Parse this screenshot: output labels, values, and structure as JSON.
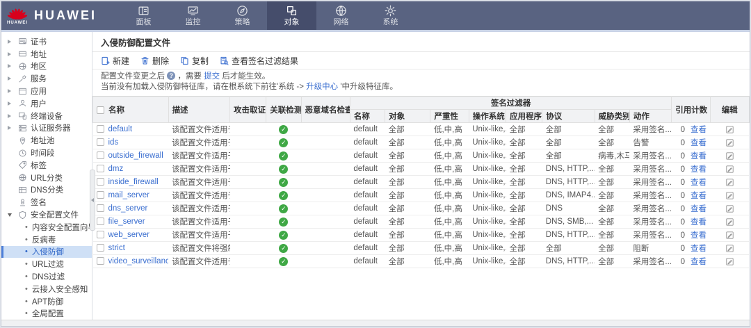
{
  "colors": {
    "topbar": "#596381",
    "topbar_active": "#454d6b",
    "link_blue": "#3b6fd0",
    "selected_item_bg": "#cfe0f6",
    "selected_item_border": "#4d7fd9",
    "success_green": "#3fa845",
    "huawei_red": "#d8001c"
  },
  "brand": {
    "name": "HUAWEI",
    "logo_caption": "HUAWEI",
    "logo_icon": "huawei-logo"
  },
  "top_nav": {
    "items": [
      {
        "id": "dashboard",
        "label": "面板",
        "icon": "dashboard-icon",
        "active": false
      },
      {
        "id": "monitor",
        "label": "监控",
        "icon": "monitor-icon",
        "active": false
      },
      {
        "id": "policy",
        "label": "策略",
        "icon": "policy-icon",
        "active": false
      },
      {
        "id": "objects",
        "label": "对象",
        "icon": "objects-icon",
        "active": true
      },
      {
        "id": "network",
        "label": "网络",
        "icon": "network-icon",
        "active": false
      },
      {
        "id": "system",
        "label": "系统",
        "icon": "system-icon",
        "active": false
      }
    ]
  },
  "sidebar": {
    "items": [
      {
        "id": "certificate",
        "label": "证书",
        "icon": "certificate-icon",
        "arrow": "collapsed"
      },
      {
        "id": "address",
        "label": "地址",
        "icon": "address-icon",
        "arrow": "collapsed"
      },
      {
        "id": "region",
        "label": "地区",
        "icon": "region-icon",
        "arrow": "collapsed"
      },
      {
        "id": "service",
        "label": "服务",
        "icon": "service-icon",
        "arrow": "collapsed"
      },
      {
        "id": "application",
        "label": "应用",
        "icon": "application-icon",
        "arrow": "collapsed"
      },
      {
        "id": "user",
        "label": "用户",
        "icon": "user-icon",
        "arrow": "collapsed"
      },
      {
        "id": "terminal-device",
        "label": "终端设备",
        "icon": "terminal-device-icon",
        "arrow": "collapsed"
      },
      {
        "id": "auth-server",
        "label": "认证服务器",
        "icon": "auth-server-icon",
        "arrow": "collapsed"
      },
      {
        "id": "address-pool",
        "label": "地址池",
        "icon": "address-pool-icon"
      },
      {
        "id": "time-range",
        "label": "时间段",
        "icon": "time-range-icon"
      },
      {
        "id": "tag",
        "label": "标签",
        "icon": "tag-icon"
      },
      {
        "id": "url-category",
        "label": "URL分类",
        "icon": "url-category-icon"
      },
      {
        "id": "dns-category",
        "label": "DNS分类",
        "icon": "dns-category-icon"
      },
      {
        "id": "signature",
        "label": "签名",
        "icon": "signature-icon"
      },
      {
        "id": "security-profile",
        "label": "安全配置文件",
        "icon": "security-profile-icon",
        "arrow": "expanded"
      },
      {
        "id": "content-security-wizard",
        "label": "内容安全配置向导",
        "child": true
      },
      {
        "id": "antivirus",
        "label": "反病毒",
        "child": true
      },
      {
        "id": "intrusion-prevention",
        "label": "入侵防御",
        "child": true,
        "selected": true
      },
      {
        "id": "url-filter",
        "label": "URL过滤",
        "child": true
      },
      {
        "id": "dns-filter",
        "label": "DNS过滤",
        "child": true
      },
      {
        "id": "cloud-access-security",
        "label": "云接入安全感知",
        "child": true
      },
      {
        "id": "apt-defense",
        "label": "APT防御",
        "child": true
      },
      {
        "id": "global-config",
        "label": "全局配置",
        "child": true
      }
    ]
  },
  "main": {
    "title": "入侵防御配置文件",
    "toolbar": [
      {
        "id": "new",
        "label": "新建",
        "icon": "new-icon"
      },
      {
        "id": "delete",
        "label": "删除",
        "icon": "delete-icon"
      },
      {
        "id": "copy",
        "label": "复制",
        "icon": "copy-icon"
      },
      {
        "id": "view-signature-filter-results",
        "label": "查看签名过滤结果",
        "icon": "view-results-icon"
      }
    ],
    "notice": {
      "line1_pre": "配置文件变更之后",
      "help_glyph": "?",
      "line1_mid": "，需要",
      "line1_link": "提交",
      "line1_post": "后才能生效。",
      "line2_pre": "当前没有加载入侵防御特征库，请在根系统下前往'系统 ->",
      "line2_link": "升级中心",
      "line2_post": "'中升级特征库。"
    },
    "table": {
      "main_columns": [
        {
          "id": "name",
          "label": "名称"
        },
        {
          "id": "description",
          "label": "描述"
        },
        {
          "id": "attack-evidence",
          "label": "攻击取证"
        },
        {
          "id": "correlation-detection",
          "label": "关联检测"
        },
        {
          "id": "malicious-domain-check",
          "label": "恶意域名检查"
        }
      ],
      "filter_group": {
        "label": "签名过滤器",
        "columns": [
          {
            "id": "filter-name",
            "label": "名称"
          },
          {
            "id": "filter-object",
            "label": "对象"
          },
          {
            "id": "severity",
            "label": "严重性"
          },
          {
            "id": "operating-system",
            "label": "操作系统"
          },
          {
            "id": "application",
            "label": "应用程序"
          },
          {
            "id": "protocol",
            "label": "协议"
          },
          {
            "id": "threat-category",
            "label": "威胁类别"
          },
          {
            "id": "action",
            "label": "动作"
          }
        ]
      },
      "tail_columns": [
        {
          "id": "reference-count",
          "label": "引用计数"
        },
        {
          "id": "edit",
          "label": "编辑"
        }
      ],
      "view_label": "查看",
      "check_glyph": "✓",
      "rows": [
        {
          "name": "default",
          "desc": "该配置文件适用于...",
          "correlation": true,
          "filter_name": "default",
          "object": "全部",
          "severity": "低,中,高",
          "os": "Unix-like,...",
          "app": "全部",
          "protocol": "全部",
          "threat": "全部",
          "action": "采用签名...",
          "ref_count": "0"
        },
        {
          "name": "ids",
          "desc": "该配置文件适用于...",
          "correlation": true,
          "filter_name": "default",
          "object": "全部",
          "severity": "低,中,高",
          "os": "Unix-like,...",
          "app": "全部",
          "protocol": "全部",
          "threat": "全部",
          "action": "告警",
          "ref_count": "0"
        },
        {
          "name": "outside_firewall",
          "desc": "该配置文件适用于...",
          "correlation": true,
          "filter_name": "default",
          "object": "全部",
          "severity": "低,中,高",
          "os": "Unix-like,...",
          "app": "全部",
          "protocol": "全部",
          "threat": "病毒,木马...",
          "action": "采用签名...",
          "ref_count": "0"
        },
        {
          "name": "dmz",
          "desc": "该配置文件适用于...",
          "correlation": true,
          "filter_name": "default",
          "object": "全部",
          "severity": "低,中,高",
          "os": "Unix-like,...",
          "app": "全部",
          "protocol": "DNS, HTTP,...",
          "threat": "全部",
          "action": "采用签名...",
          "ref_count": "0"
        },
        {
          "name": "inside_firewall",
          "desc": "该配置文件适用于...",
          "correlation": true,
          "filter_name": "default",
          "object": "全部",
          "severity": "低,中,高",
          "os": "Unix-like,...",
          "app": "全部",
          "protocol": "DNS, HTTP,...",
          "threat": "全部",
          "action": "采用签名...",
          "ref_count": "0"
        },
        {
          "name": "mail_server",
          "desc": "该配置文件适用于...",
          "correlation": true,
          "filter_name": "default",
          "object": "全部",
          "severity": "低,中,高",
          "os": "Unix-like,...",
          "app": "全部",
          "protocol": "DNS, IMAP4...",
          "threat": "全部",
          "action": "采用签名...",
          "ref_count": "0"
        },
        {
          "name": "dns_server",
          "desc": "该配置文件适用于...",
          "correlation": true,
          "filter_name": "default",
          "object": "全部",
          "severity": "低,中,高",
          "os": "Unix-like,...",
          "app": "全部",
          "protocol": "DNS",
          "threat": "全部",
          "action": "采用签名...",
          "ref_count": "0"
        },
        {
          "name": "file_server",
          "desc": "该配置文件适用于...",
          "correlation": true,
          "filter_name": "default",
          "object": "全部",
          "severity": "低,中,高",
          "os": "Unix-like,...",
          "app": "全部",
          "protocol": "DNS, SMB,...",
          "threat": "全部",
          "action": "采用签名...",
          "ref_count": "0"
        },
        {
          "name": "web_server",
          "desc": "该配置文件适用于...",
          "correlation": true,
          "filter_name": "default",
          "object": "全部",
          "severity": "低,中,高",
          "os": "Unix-like,...",
          "app": "全部",
          "protocol": "DNS, HTTP,...",
          "threat": "全部",
          "action": "采用签名...",
          "ref_count": "0"
        },
        {
          "name": "strict",
          "desc": "该配置文件将强制...",
          "correlation": true,
          "filter_name": "default",
          "object": "全部",
          "severity": "低,中,高",
          "os": "Unix-like,...",
          "app": "全部",
          "protocol": "全部",
          "threat": "全部",
          "action": "阻断",
          "ref_count": "0"
        },
        {
          "name": "video_surveillance",
          "desc": "该配置文件适用于...",
          "correlation": true,
          "filter_name": "default",
          "object": "全部",
          "severity": "低,中,高",
          "os": "Unix-like,...",
          "app": "全部",
          "protocol": "DNS, HTTP,...",
          "threat": "全部",
          "action": "采用签名...",
          "ref_count": "0"
        }
      ]
    }
  }
}
